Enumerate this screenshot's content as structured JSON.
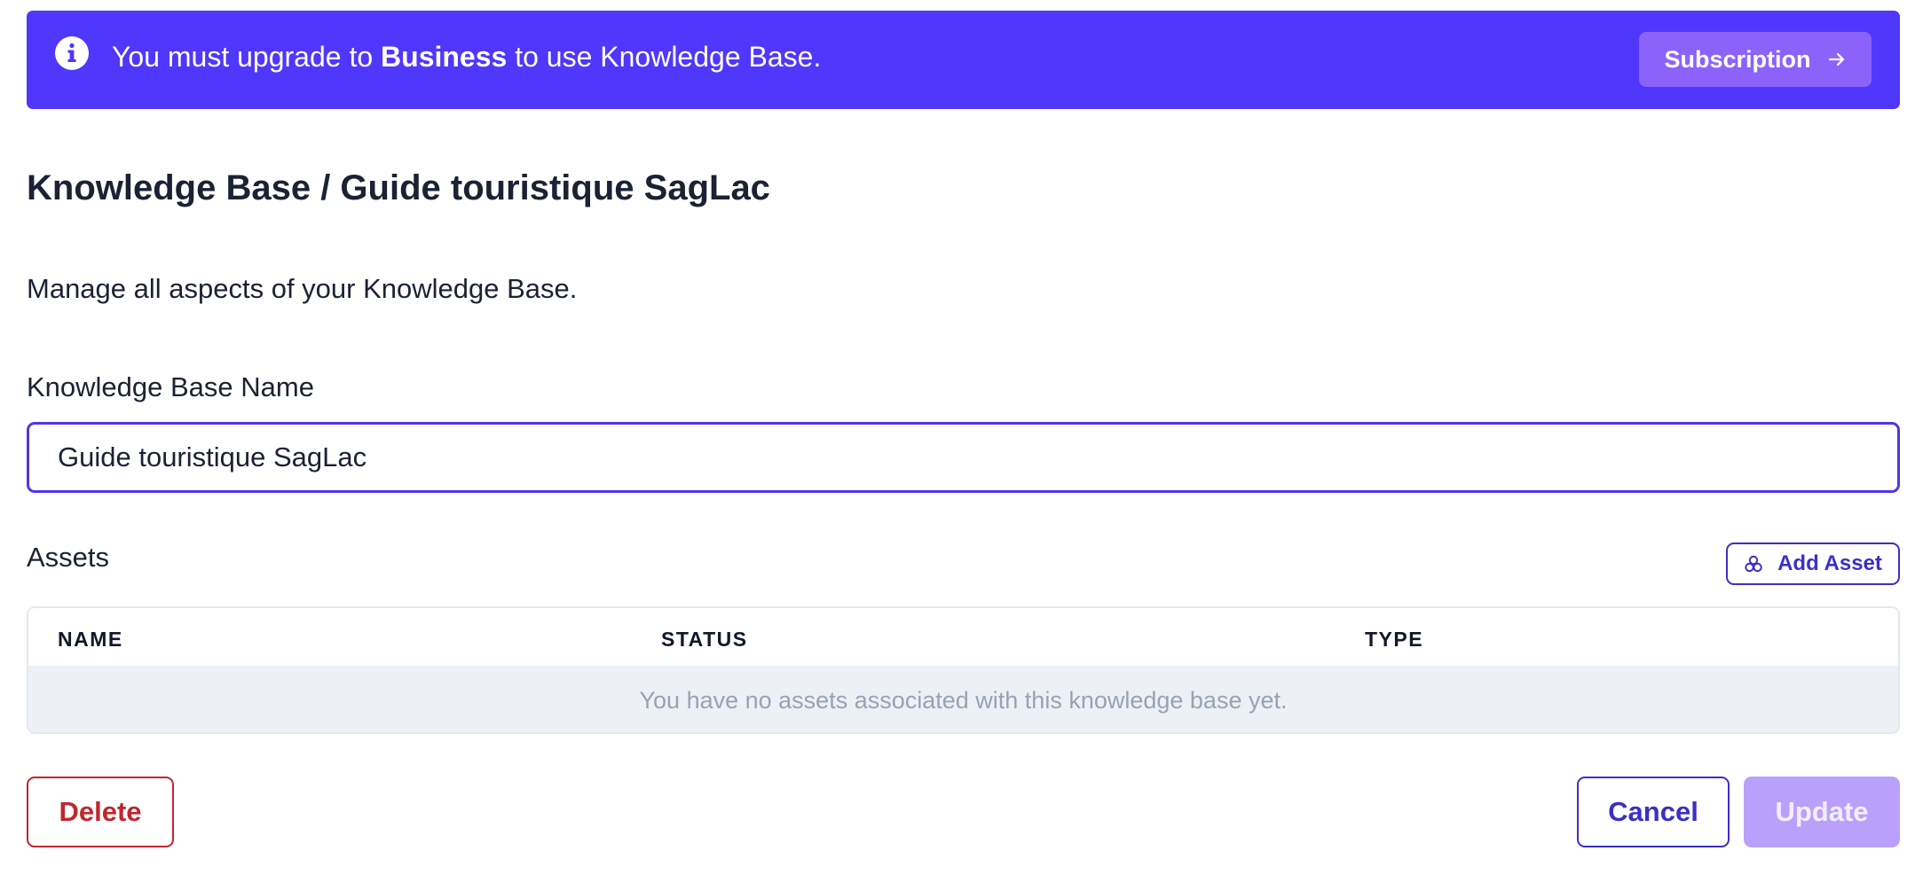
{
  "banner": {
    "text_before": "You must upgrade to ",
    "plan": "Business",
    "text_after": " to use Knowledge Base.",
    "subscription_label": "Subscription",
    "info_icon": "info-circle-icon",
    "arrow_icon": "arrow-right-icon"
  },
  "header": {
    "title": "Knowledge Base / Guide touristique SagLac",
    "description": "Manage all aspects of your Knowledge Base."
  },
  "form": {
    "name_label": "Knowledge Base Name",
    "name_value": "Guide touristique SagLac"
  },
  "assets": {
    "label": "Assets",
    "add_label": "Add Asset",
    "add_icon": "cubes-icon",
    "columns": [
      "NAME",
      "STATUS",
      "TYPE"
    ],
    "empty_message": "You have no assets associated with this knowledge base yet."
  },
  "actions": {
    "delete_label": "Delete",
    "cancel_label": "Cancel",
    "update_label": "Update"
  },
  "colors": {
    "banner_bg": "#4f37fb",
    "subscription_bg": "#8b63fb",
    "accent": "#3b2fc9",
    "danger": "#c0272d",
    "update_disabled_bg": "#b9a1fb",
    "empty_row_bg": "#edf1f6"
  }
}
